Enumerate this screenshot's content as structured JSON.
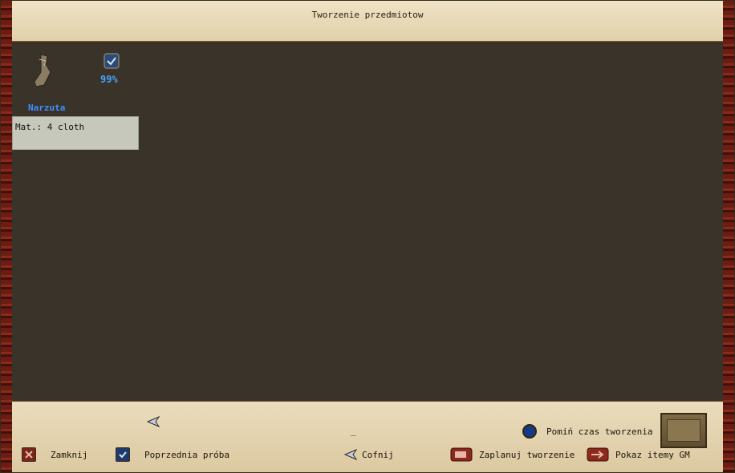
{
  "window": {
    "title": "Tworzenie przedmiotow"
  },
  "item": {
    "name": "Narzuta",
    "success_chance": "99%",
    "materials": "Mat.: 4 cloth",
    "icon": "cloak-icon"
  },
  "footer": {
    "page_back_icon": "arrow-left-icon",
    "underscore": "_",
    "close_label": "Zamknij",
    "previous_attempt_label": "Poprzednia próba",
    "back_label": "Cofnij",
    "schedule_label": "Zaplanuj tworzenie",
    "show_gm_label": "Pokaz itemy GM",
    "skip_time_label": "Pomiń czas tworzenia"
  },
  "colors": {
    "parchment": "#e7d9b8",
    "panel": "#39332a",
    "accent_blue": "#4aa2ff",
    "border_red": "#8b2a1c"
  }
}
